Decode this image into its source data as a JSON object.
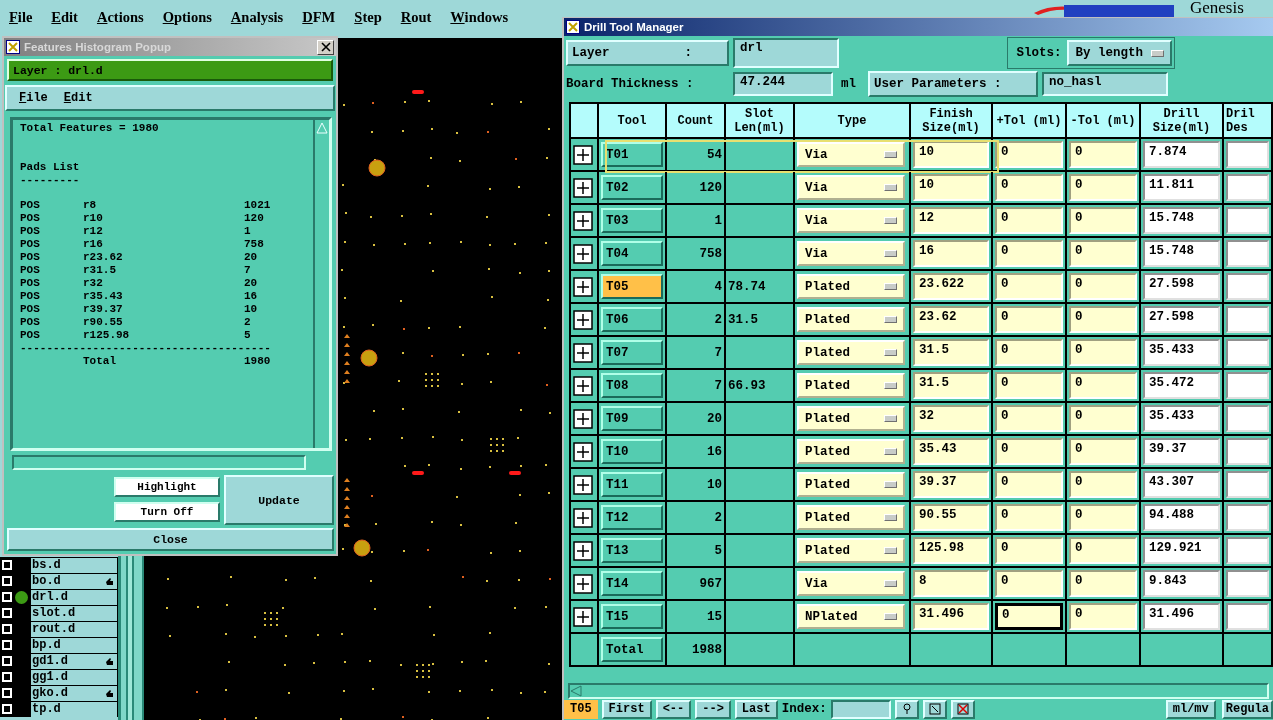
{
  "menu": [
    "File",
    "Edit",
    "Actions",
    "Options",
    "Analysis",
    "DFM",
    "Step",
    "Rout",
    "Windows"
  ],
  "logo_text": "Genesis",
  "histogram_popup": {
    "title": "Features Histogram Popup",
    "layer": "Layer :  drl.d",
    "menu": [
      "File",
      "Edit"
    ],
    "total_line": "Total Features = 1980",
    "section": "Pads List",
    "underline": "---------",
    "pads": [
      {
        "polarity": "POS",
        "symbol": "r8",
        "count": "1021"
      },
      {
        "polarity": "POS",
        "symbol": "r10",
        "count": "120"
      },
      {
        "polarity": "POS",
        "symbol": "r12",
        "count": "1"
      },
      {
        "polarity": "POS",
        "symbol": "r16",
        "count": "758"
      },
      {
        "polarity": "POS",
        "symbol": "r23.62",
        "count": "20"
      },
      {
        "polarity": "POS",
        "symbol": "r31.5",
        "count": "7"
      },
      {
        "polarity": "POS",
        "symbol": "r32",
        "count": "20"
      },
      {
        "polarity": "POS",
        "symbol": "r35.43",
        "count": "16"
      },
      {
        "polarity": "POS",
        "symbol": "r39.37",
        "count": "10"
      },
      {
        "polarity": "POS",
        "symbol": "r90.55",
        "count": "2"
      },
      {
        "polarity": "POS",
        "symbol": "r125.98",
        "count": "5"
      }
    ],
    "separator": "--------------------------------------",
    "total_label": "Total",
    "total_count": "1980",
    "highlight": "Highlight",
    "turn_off": "Turn Off",
    "update": "Update",
    "close": "Close"
  },
  "layers": [
    {
      "name": "bs.d",
      "checked": false,
      "active": false,
      "hand": false
    },
    {
      "name": "bo.d",
      "checked": false,
      "active": false,
      "hand": true
    },
    {
      "name": "drl.d",
      "checked": false,
      "active": true,
      "hand": false
    },
    {
      "name": "slot.d",
      "checked": false,
      "active": false,
      "hand": false
    },
    {
      "name": "rout.d",
      "checked": false,
      "active": false,
      "hand": false
    },
    {
      "name": "bp.d",
      "checked": false,
      "active": false,
      "hand": false
    },
    {
      "name": "gd1.d",
      "checked": false,
      "active": false,
      "hand": true
    },
    {
      "name": "gg1.d",
      "checked": false,
      "active": false,
      "hand": false
    },
    {
      "name": "gko.d",
      "checked": false,
      "active": false,
      "hand": true
    },
    {
      "name": "tp.d",
      "checked": false,
      "active": false,
      "hand": false
    }
  ],
  "drill_tool_manager": {
    "title": "Drill Tool Manager",
    "layer_label": "Layer          :",
    "layer_value": "drl",
    "slots_label": "Slots:",
    "slots_value": "By length",
    "thickness_label": "Board Thickness :",
    "thickness_value": "47.244",
    "thickness_unit": "ml",
    "user_params_label": "User Parameters :",
    "user_params_value": "no_hasl",
    "columns": [
      "Tool",
      "Count",
      "Slot Len(ml)",
      "Type",
      "Finish Size(ml)",
      "+Tol (ml)",
      "-Tol (ml)",
      "Drill Size(ml)",
      "Dril Des"
    ],
    "rows": [
      {
        "tool": "T01",
        "count": "54",
        "type": "Via",
        "finish": "10",
        "plus_tol": "0",
        "minus_tol": "0",
        "drill": "7.874",
        "selected": false,
        "highlighted": true,
        "plus_tol_focused": false
      },
      {
        "tool": "T02",
        "count": "120",
        "type": "Via",
        "finish": "10",
        "plus_tol": "0",
        "minus_tol": "0",
        "drill": "11.811",
        "selected": false,
        "highlighted": false,
        "plus_tol_focused": false
      },
      {
        "tool": "T03",
        "count": "1",
        "type": "Via",
        "finish": "12",
        "plus_tol": "0",
        "minus_tol": "0",
        "drill": "15.748",
        "selected": false,
        "highlighted": false,
        "plus_tol_focused": false
      },
      {
        "tool": "T04",
        "count": "758",
        "type": "Via",
        "finish": "16",
        "plus_tol": "0",
        "minus_tol": "0",
        "drill": "15.748",
        "selected": false,
        "highlighted": false,
        "plus_tol_focused": false
      },
      {
        "tool": "T05",
        "count": "4",
        "slot_len": "78.74",
        "type": "Plated",
        "finish": "23.622",
        "plus_tol": "0",
        "minus_tol": "0",
        "drill": "27.598",
        "selected": true,
        "highlighted": false,
        "plus_tol_focused": false
      },
      {
        "tool": "T06",
        "count": "2",
        "slot_len": "31.5",
        "type": "Plated",
        "finish": "23.62",
        "plus_tol": "0",
        "minus_tol": "0",
        "drill": "27.598",
        "selected": false,
        "highlighted": false,
        "plus_tol_focused": false
      },
      {
        "tool": "T07",
        "count": "7",
        "type": "Plated",
        "finish": "31.5",
        "plus_tol": "0",
        "minus_tol": "0",
        "drill": "35.433",
        "selected": false,
        "highlighted": false,
        "plus_tol_focused": false
      },
      {
        "tool": "T08",
        "count": "7",
        "slot_len": "66.93",
        "type": "Plated",
        "finish": "31.5",
        "plus_tol": "0",
        "minus_tol": "0",
        "drill": "35.472",
        "selected": false,
        "highlighted": false,
        "plus_tol_focused": false
      },
      {
        "tool": "T09",
        "count": "20",
        "type": "Plated",
        "finish": "32",
        "plus_tol": "0",
        "minus_tol": "0",
        "drill": "35.433",
        "selected": false,
        "highlighted": false,
        "plus_tol_focused": false
      },
      {
        "tool": "T10",
        "count": "16",
        "type": "Plated",
        "finish": "35.43",
        "plus_tol": "0",
        "minus_tol": "0",
        "drill": "39.37",
        "selected": false,
        "highlighted": false,
        "plus_tol_focused": false
      },
      {
        "tool": "T11",
        "count": "10",
        "type": "Plated",
        "finish": "39.37",
        "plus_tol": "0",
        "minus_tol": "0",
        "drill": "43.307",
        "selected": false,
        "highlighted": false,
        "plus_tol_focused": false
      },
      {
        "tool": "T12",
        "count": "2",
        "type": "Plated",
        "finish": "90.55",
        "plus_tol": "0",
        "minus_tol": "0",
        "drill": "94.488",
        "selected": false,
        "highlighted": false,
        "plus_tol_focused": false
      },
      {
        "tool": "T13",
        "count": "5",
        "type": "Plated",
        "finish": "125.98",
        "plus_tol": "0",
        "minus_tol": "0",
        "drill": "129.921",
        "selected": false,
        "highlighted": false,
        "plus_tol_focused": false
      },
      {
        "tool": "T14",
        "count": "967",
        "type": "Via",
        "finish": "8",
        "plus_tol": "0",
        "minus_tol": "0",
        "drill": "9.843",
        "selected": false,
        "highlighted": false,
        "plus_tol_focused": false
      },
      {
        "tool": "T15",
        "count": "15",
        "type": "NPlated",
        "finish": "31.496",
        "plus_tol": "0",
        "minus_tol": "0",
        "drill": "31.496",
        "selected": false,
        "highlighted": false,
        "plus_tol_focused": true
      }
    ],
    "total_label": "Total",
    "total_count": "1988",
    "current_tool": "T05",
    "nav_buttons": [
      "First",
      "<--",
      "-->",
      "Last"
    ],
    "index_label": "Index:",
    "units": "ml/mv",
    "mode": "Regula"
  }
}
